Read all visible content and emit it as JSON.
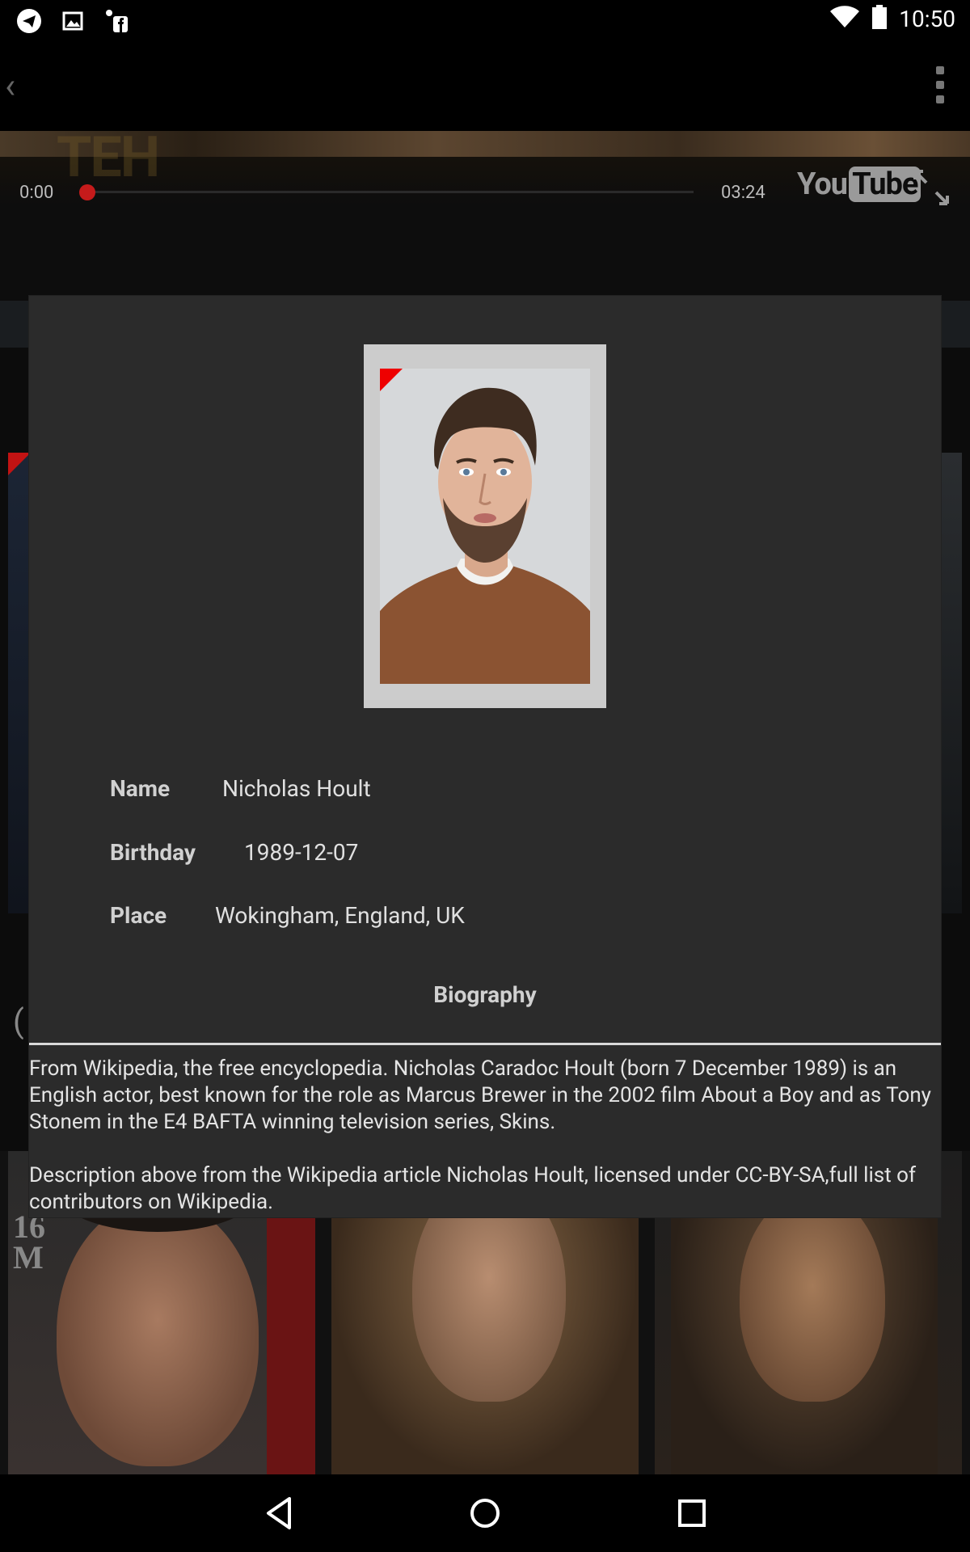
{
  "status_bar": {
    "time": "10:50",
    "left_icons": [
      "telegram-icon",
      "image-icon",
      "facebook-icon"
    ],
    "right_icons": [
      "wifi-icon",
      "battery-icon"
    ]
  },
  "action_bar": {
    "back_icon": "chevron-left-icon",
    "overflow_icon": "more-vert-icon"
  },
  "video_player": {
    "overlay_text": "TEH",
    "current_time": "0:00",
    "duration": "03:24",
    "progress_fraction": 0.0,
    "brand_you": "You",
    "brand_tube": "Tube"
  },
  "person": {
    "name_label": "Name",
    "name_value": "Nicholas Hoult",
    "birthday_label": "Birthday",
    "birthday_value": "1989-12-07",
    "place_label": "Place",
    "place_value": "Wokingham, England, UK",
    "biography_title": "Biography",
    "biography_paragraph1": "From Wikipedia, the free encyclopedia.  Nicholas Caradoc Hoult (born 7 December 1989) is an English actor, best known for the role as Marcus Brewer in the 2002 film About a Boy and as Tony Stonem in the E4 BAFTA winning television series, Skins.",
    "biography_paragraph2": "Description above from the Wikipedia article Nicholas Hoult, licensed under CC-BY-SA,full list of contributors on Wikipedia."
  },
  "background": {
    "paren_glyph": "(",
    "magazine_text_1": "16",
    "magazine_text_2": "M"
  },
  "colors": {
    "dialog_bg": "#2b2b2b",
    "accent_red": "#e00000",
    "frame": "#cccccc"
  }
}
